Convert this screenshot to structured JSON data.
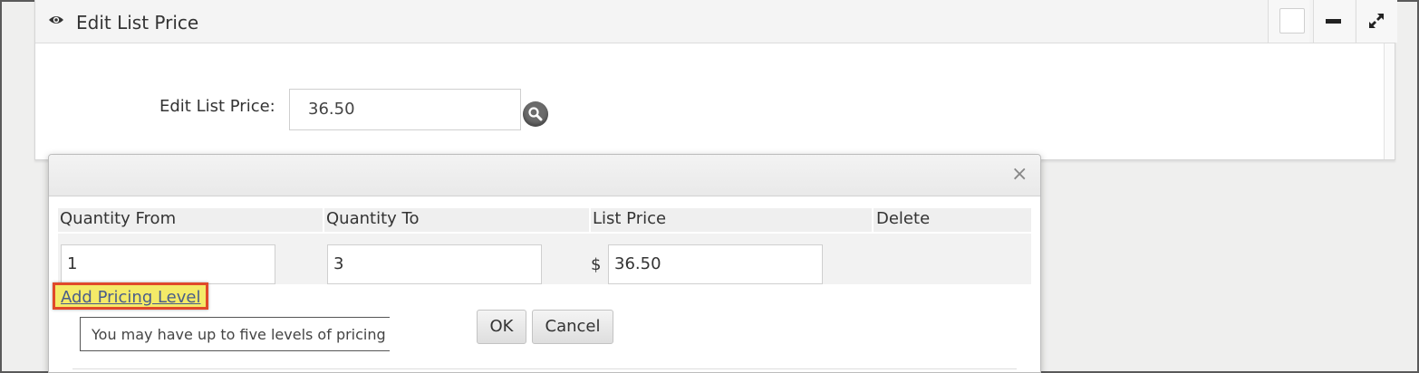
{
  "panel": {
    "title": "Edit List Price",
    "icons": [
      "eye-icon",
      "checkbox-icon",
      "minimize-icon",
      "expand-icon"
    ]
  },
  "field": {
    "label": "Edit List Price:",
    "value": "36.50"
  },
  "dialog": {
    "close_label": "×",
    "columns": [
      "Quantity From",
      "Quantity To",
      "List Price",
      "Delete"
    ],
    "rows": [
      {
        "from": "1",
        "to": "3",
        "currency": "$",
        "price": "36.50"
      }
    ],
    "add_link": "Add Pricing Level",
    "tooltip": "You may have up to five levels of pricing",
    "ok_label": "OK",
    "cancel_label": "Cancel"
  },
  "colors": {
    "highlight_fill": "#f4ea68",
    "highlight_border": "#e0492a",
    "link": "#4a5d8a"
  }
}
